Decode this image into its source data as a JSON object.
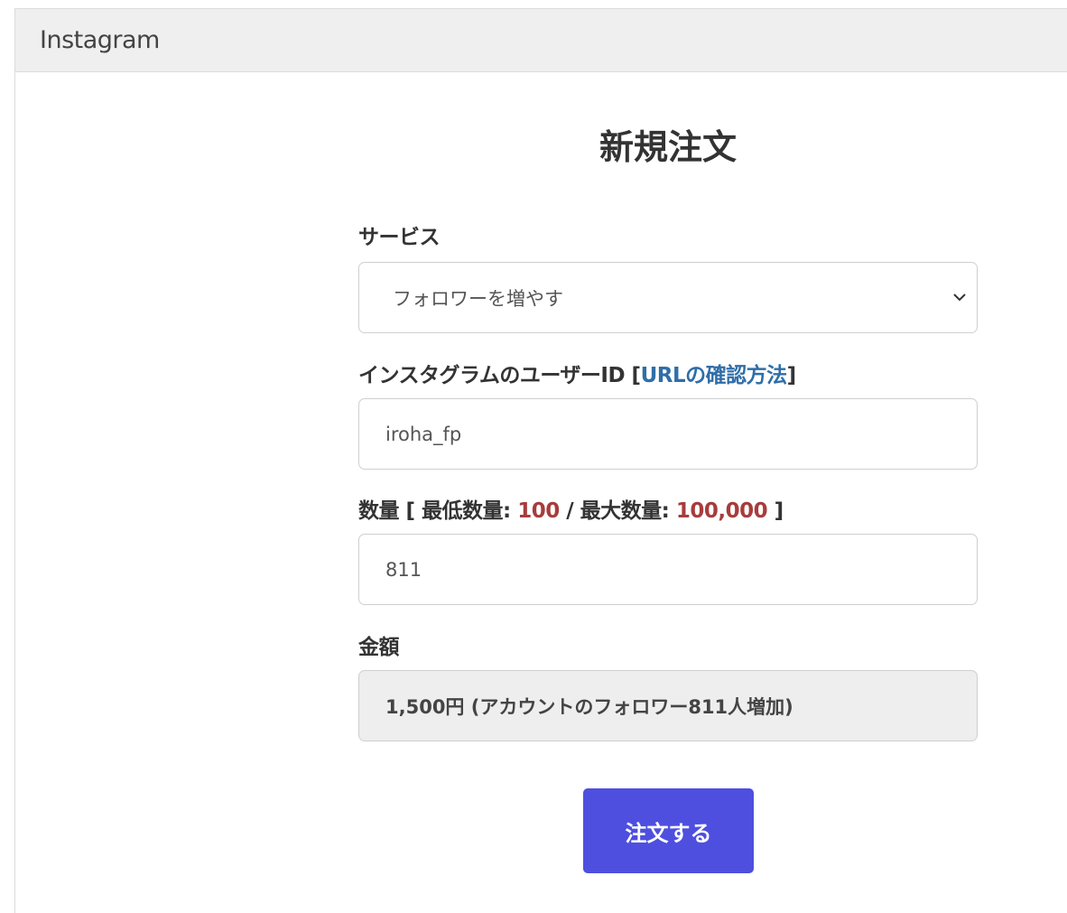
{
  "panel": {
    "title": "Instagram"
  },
  "form": {
    "title": "新規注文",
    "service": {
      "label": "サービス",
      "selected": "フォロワーを増やす"
    },
    "user_id": {
      "label_prefix": "インスタグラムのユーザーID [",
      "link_text": "URLの確認方法",
      "label_suffix": "]",
      "value": "iroha_fp"
    },
    "quantity": {
      "label_prefix": "数量 [ 最低数量: ",
      "min": "100",
      "label_mid": " / 最大数量: ",
      "max": "100,000",
      "label_suffix": " ]",
      "value": "811"
    },
    "amount": {
      "label": "金額",
      "value": "1,500円 (アカウントのフォロワー811人増加)"
    },
    "submit_label": "注文する"
  },
  "colors": {
    "accent": "#4e4fdf",
    "link": "#2f6ea8",
    "limit_value": "#a83c3c",
    "header_bg": "#efefef",
    "readonly_bg": "#eeeeee"
  },
  "icons": {
    "select_arrow": "chevron-down-icon"
  }
}
